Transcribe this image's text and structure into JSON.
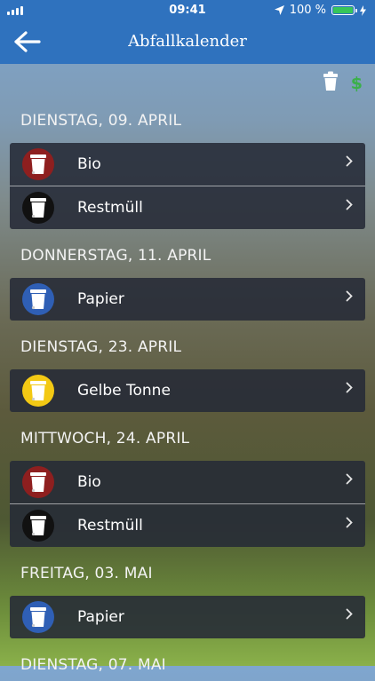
{
  "status_bar": {
    "time": "09:41",
    "battery": "100 %"
  },
  "nav": {
    "title": "Abfallkalender",
    "back_icon": "arrow-left-icon"
  },
  "toolbar": {
    "icons": [
      "bin-filter-icon",
      "dollar-sign-icon"
    ],
    "dollar_glyph": "$"
  },
  "colors": {
    "bar": "#2f72be",
    "bio": "#8e1f1f",
    "restmuell": "#111111",
    "papier": "#2f5fb5",
    "gelbe_tonne": "#f3c914"
  },
  "days": [
    {
      "date": "DIENSTAG, 09. APRIL",
      "items": [
        {
          "label": "Bio",
          "color": "#8e1f1f"
        },
        {
          "label": "Restmüll",
          "color": "#111111"
        }
      ]
    },
    {
      "date": "DONNERSTAG, 11. APRIL",
      "items": [
        {
          "label": "Papier",
          "color": "#2f5fb5"
        }
      ]
    },
    {
      "date": "DIENSTAG, 23. APRIL",
      "items": [
        {
          "label": "Gelbe Tonne",
          "color": "#f3c914"
        }
      ]
    },
    {
      "date": "MITTWOCH, 24. APRIL",
      "items": [
        {
          "label": "Bio",
          "color": "#8e1f1f"
        },
        {
          "label": "Restmüll",
          "color": "#111111"
        }
      ]
    },
    {
      "date": "FREITAG, 03. MAI",
      "items": [
        {
          "label": "Papier",
          "color": "#2f5fb5"
        }
      ]
    },
    {
      "date": "DIENSTAG, 07. MAI",
      "items": []
    }
  ]
}
